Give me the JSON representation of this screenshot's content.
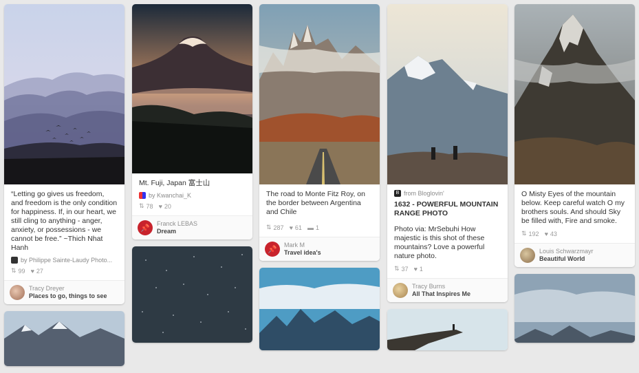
{
  "pins": {
    "c1p1": {
      "description": "“Letting go gives us freedom, and freedom is the only condition for happiness. If, in our heart, we still cling to anything - anger, anxiety, or possessions - we cannot be free.” ~Thich Nhat Hanh",
      "via": "by Philippe Sainte-Laudy Photo...",
      "repins": "99",
      "likes": "27",
      "user": "Tracy Dreyer",
      "board": "Places to go, things to see"
    },
    "c2p1": {
      "description": "Mt. Fuji, Japan 富士山",
      "via": "by Kwanchai_K",
      "repins": "78",
      "likes": "20",
      "user": "Franck LEBAS",
      "board": "Dream"
    },
    "c3p1": {
      "description": "The road to Monte Fitz Roy, on the border between Argentina and Chile",
      "repins": "287",
      "likes": "61",
      "comments": "1",
      "user": "Mark M",
      "board": "Travel idea's"
    },
    "c4p1": {
      "source": "from Bloglovin'",
      "title": "1632 - POWERFUL MOUNTAIN RANGE PHOTO",
      "description": "Photo via: MrSebuhi How majestic is this shot of these mountains? Love a powerful nature photo.",
      "repins": "37",
      "likes": "1",
      "user": "Tracy Burns",
      "board": "All That Inspires Me"
    },
    "c5p1": {
      "description": "O Misty Eyes of the mountain below. Keep careful watch O my brothers souls. And should Sky be filled with, Fire and smoke.",
      "repins": "192",
      "likes": "43",
      "user": "Louis Schwarzmayr",
      "board": "Beautiful World"
    }
  },
  "colors": {
    "background": "#e9e9e9",
    "pin_red": "#c8232c"
  }
}
